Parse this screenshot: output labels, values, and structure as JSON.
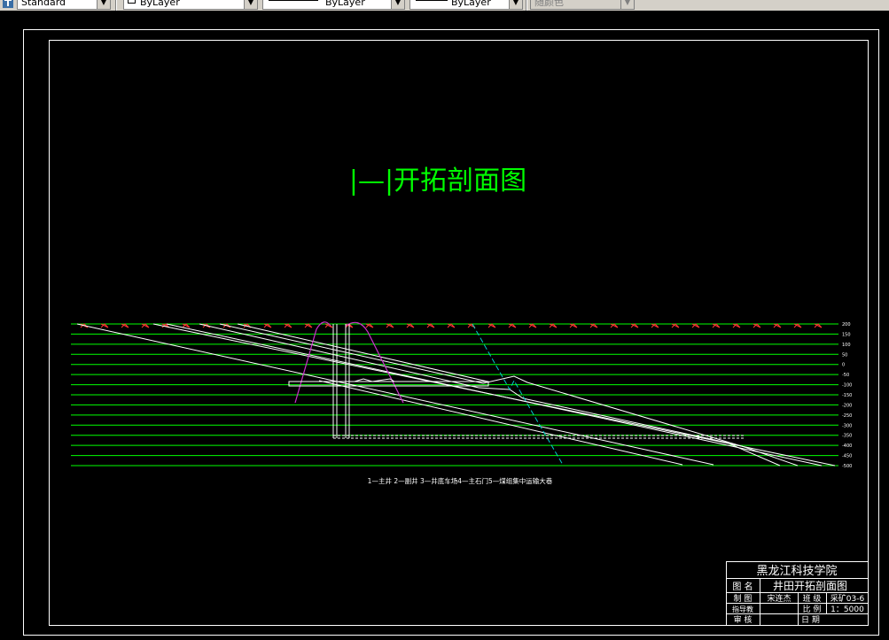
{
  "toolbar": {
    "text_style": "Standard",
    "layer": "ByLayer",
    "linetype": "ByLayer",
    "lineweight": "ByLayer",
    "plot_color": "随颜色"
  },
  "drawing": {
    "title": "|—|开拓剖面图",
    "legend_caption": "1—主井 2—副井 3—井底车场4—主石门5—煤组集中运输大巷",
    "depth_labels": [
      "200",
      "150",
      "100",
      "50",
      "0",
      "-50",
      "-100",
      "-150",
      "-200",
      "-250",
      "-300",
      "-350",
      "-400",
      "-450",
      "-500"
    ],
    "colors": {
      "background": "#000000",
      "frame": "#ffffff",
      "level_lines": "#00ff00",
      "surface_marks": "#ff3333",
      "title": "#00ff00",
      "fault": "#00cccc",
      "protection_pillar": "#cc33cc",
      "strata": "#ffffff"
    }
  },
  "title_block": {
    "institution": "黑龙江科技学院",
    "drawing_name_label": "图 名",
    "drawing_name": "井田开拓剖面图",
    "drawn_by_label": "制 图",
    "drawn_by": "宋连杰",
    "class_label": "班 级",
    "class_value": "采矿03-6",
    "instructor_label": "指导教",
    "instructor": "",
    "scale_label": "比 例",
    "scale_value": "1：5000",
    "reviewer_label": "审 核",
    "reviewer": "",
    "date_label": "日 期",
    "date_value": ""
  }
}
